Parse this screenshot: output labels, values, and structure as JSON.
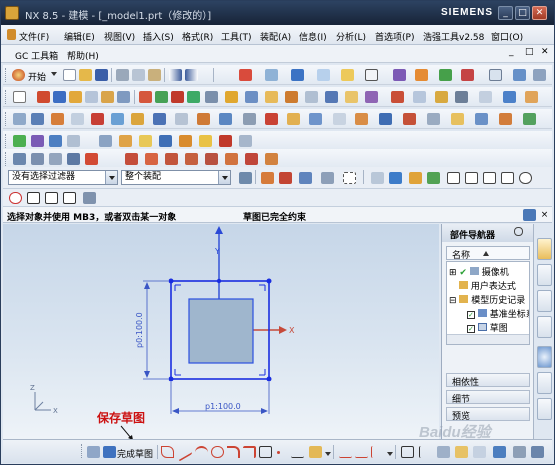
{
  "window": {
    "title": "NX 8.5 - 建模 - [_model1.prt（修改的）]",
    "brand": "SIEMENS",
    "minimize_label": "_",
    "maximize_label": "□",
    "close_label": "✕"
  },
  "menubar": {
    "items": [
      "文件(F)",
      "编辑(E)",
      "视图(V)",
      "插入(S)",
      "格式(R)",
      "工具(T)",
      "装配(A)",
      "信息(I)",
      "分析(L)",
      "首选项(P)",
      "浩强工具v2.58",
      "窗口(O)"
    ],
    "row2_items": [
      "GC 工具箱",
      "帮助(H)"
    ],
    "mdi_buttons": [
      "_",
      "□",
      "✕"
    ]
  },
  "toolbar1": {
    "start_label": "开始"
  },
  "filter": {
    "type_filter": "没有选择过滤器",
    "scope_filter": "整个装配"
  },
  "status": {
    "prompt": "选择对象并使用 MB3，或者双击某一对象",
    "sketch_status": "草图已完全约束"
  },
  "canvas": {
    "dim_vertical": "p0:100.0",
    "dim_horizontal": "p1:100.0",
    "axis_x": "X",
    "axis_y": "Y",
    "axis_z": "Z"
  },
  "navigator": {
    "title": "部件导航器",
    "column_name": "名称",
    "tree": [
      {
        "label": "摄像机",
        "checked": true
      },
      {
        "label": "用户表达式",
        "checked": false
      },
      {
        "label": "模型历史记录",
        "checked": false
      },
      {
        "label": "基准坐标系",
        "checked": true
      },
      {
        "label": "草图",
        "checked": true
      }
    ],
    "panels": [
      "相依性",
      "细节",
      "预览"
    ]
  },
  "bottombar": {
    "finish_sketch_label": "完成草图"
  },
  "annotation": {
    "text": "保存草图"
  },
  "watermark": "Baidu经验",
  "colors": {
    "titlebar": "#1d2c45",
    "canvas_top": "#c6d6e8",
    "sketch_line": "#1a2ee0",
    "annotation": "#cc1111"
  }
}
